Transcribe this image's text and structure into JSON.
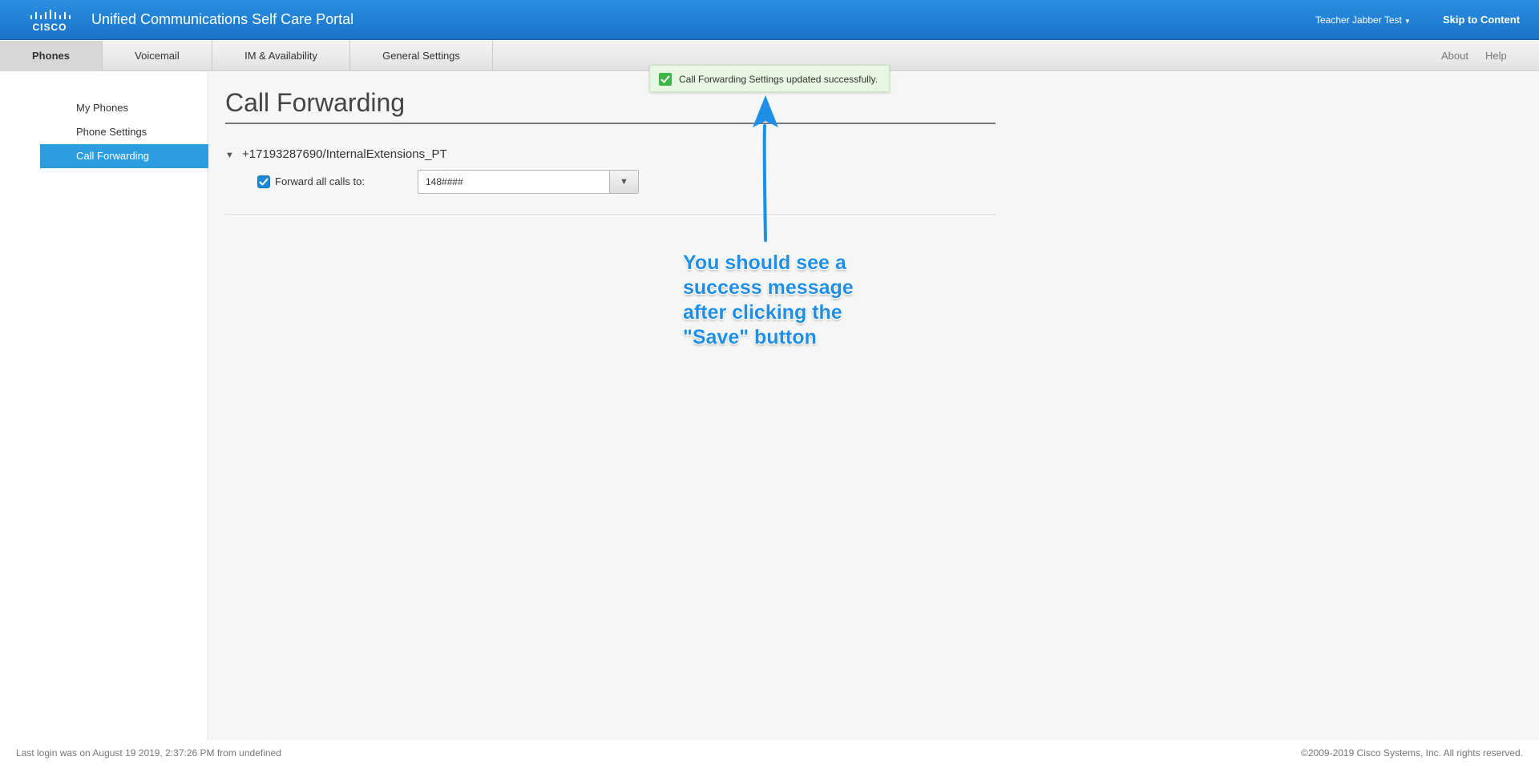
{
  "header": {
    "logo_text": "CISCO",
    "app_title": "Unified Communications Self Care Portal",
    "user_name": "Teacher Jabber Test",
    "skip_link": "Skip to Content"
  },
  "nav": {
    "tabs": [
      {
        "label": "Phones",
        "active": true
      },
      {
        "label": "Voicemail"
      },
      {
        "label": "IM & Availability"
      },
      {
        "label": "General Settings"
      }
    ],
    "right_links": [
      {
        "label": "About"
      },
      {
        "label": "Help"
      }
    ]
  },
  "sidebar": {
    "items": [
      {
        "label": "My Phones"
      },
      {
        "label": "Phone Settings"
      },
      {
        "label": "Call Forwarding",
        "active": true
      }
    ]
  },
  "main": {
    "title": "Call Forwarding",
    "line_label": "+17193287690/InternalExtensions_PT",
    "forward_all": {
      "checked": true,
      "label": "Forward all calls to:",
      "value": "148####"
    }
  },
  "toast": {
    "message": "Call Forwarding Settings updated successfully."
  },
  "annotation": {
    "lines": [
      "You should see a",
      "success message",
      "after clicking the",
      "\"Save\" button"
    ]
  },
  "footer": {
    "last_login": "Last login was on August 19 2019, 2:37:26 PM from undefined",
    "copyright": "©2009-2019 Cisco Systems, Inc. All rights reserved."
  },
  "colors": {
    "header_blue": "#1f80d6",
    "active_sidebar": "#2c9ee0",
    "toast_bg": "#e7f6e2",
    "toast_icon": "#3fb545",
    "annotation": "#1f8ee6"
  }
}
